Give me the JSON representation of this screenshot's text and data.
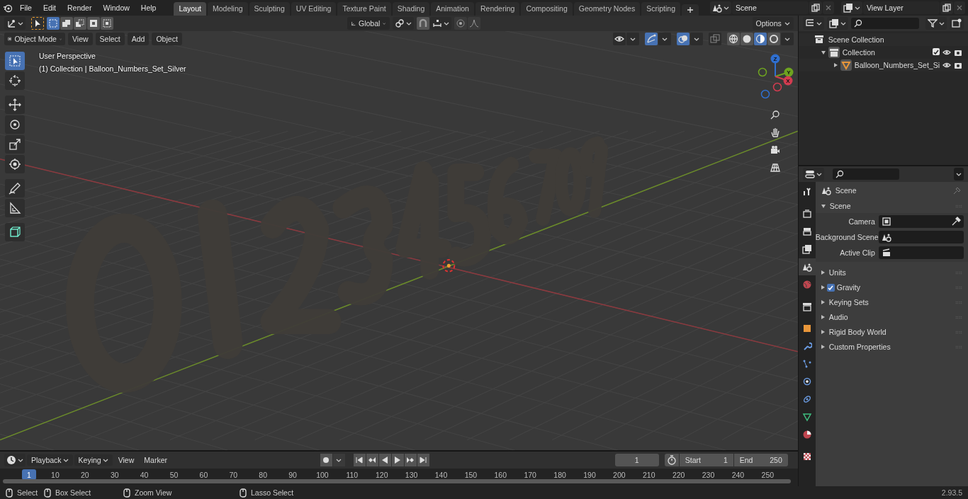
{
  "menu": [
    "File",
    "Edit",
    "Render",
    "Window",
    "Help"
  ],
  "workspaces": [
    {
      "label": "Layout",
      "selected": true
    },
    {
      "label": "Modeling",
      "selected": false
    },
    {
      "label": "Sculpting",
      "selected": false
    },
    {
      "label": "UV Editing",
      "selected": false
    },
    {
      "label": "Texture Paint",
      "selected": false
    },
    {
      "label": "Shading",
      "selected": false
    },
    {
      "label": "Animation",
      "selected": false
    },
    {
      "label": "Rendering",
      "selected": false
    },
    {
      "label": "Compositing",
      "selected": false
    },
    {
      "label": "Geometry Nodes",
      "selected": false
    },
    {
      "label": "Scripting",
      "selected": false
    }
  ],
  "scene_selector": {
    "value": "Scene"
  },
  "view_layer_selector": {
    "value": "View Layer"
  },
  "tool_header": {
    "select_modes": [
      {
        "kind": "set",
        "selected": true
      },
      {
        "kind": "extend",
        "selected": false
      },
      {
        "kind": "subtract",
        "selected": false
      },
      {
        "kind": "difference",
        "selected": false
      },
      {
        "kind": "intersect",
        "selected": false
      }
    ],
    "orientation": "Global",
    "options": "Options"
  },
  "viewport_header": {
    "mode": "Object Mode",
    "menus": [
      "View",
      "Select",
      "Add",
      "Object"
    ],
    "toggles": [
      {
        "kind": "visibility",
        "on": false
      },
      {
        "kind": "gizmos",
        "on": true
      },
      {
        "kind": "overlays",
        "on": true
      },
      {
        "kind": "xray",
        "on": false
      }
    ],
    "shading": [
      {
        "kind": "wireframe",
        "selected": false
      },
      {
        "kind": "solid",
        "selected": false
      },
      {
        "kind": "material",
        "selected": true
      },
      {
        "kind": "rendered",
        "selected": false
      }
    ]
  },
  "viewport": {
    "perspective": "User Perspective",
    "collection_info": "(1) Collection | Balloon_Numbers_Set_Silver",
    "tools": [
      {
        "kind": "select",
        "selected": true
      },
      {
        "kind": "cursor",
        "selected": false
      },
      {
        "kind": "move",
        "selected": false
      },
      {
        "kind": "rotate",
        "selected": false
      },
      {
        "kind": "scale",
        "selected": false
      },
      {
        "kind": "transform",
        "selected": false
      },
      {
        "kind": "annotate",
        "selected": false
      },
      {
        "kind": "measure",
        "selected": false
      },
      {
        "kind": "add_cube",
        "selected": false
      }
    ],
    "gizmo_axes": [
      {
        "label": "Z",
        "color": "#2f6fd0"
      },
      {
        "label": "Y",
        "color": "#6ea320"
      },
      {
        "label": "X",
        "color": "#d33c50"
      }
    ]
  },
  "outliner": {
    "tree": [
      {
        "label": "Scene Collection",
        "children": [
          {
            "label": "Collection",
            "expanded": true,
            "checked": true,
            "children": [
              {
                "label": "Balloon_Numbers_Set_Si",
                "expanded": false
              }
            ]
          }
        ]
      }
    ]
  },
  "properties": {
    "tabs": [
      {
        "kind": "tool",
        "selected": false
      },
      {
        "kind": "render",
        "selected": false
      },
      {
        "kind": "output",
        "selected": false
      },
      {
        "kind": "view_layer",
        "selected": false
      },
      {
        "kind": "scene",
        "selected": true
      },
      {
        "kind": "world",
        "selected": false
      },
      {
        "kind": "collection",
        "selected": false
      },
      {
        "kind": "object",
        "selected": false
      },
      {
        "kind": "modifiers",
        "selected": false
      },
      {
        "kind": "particles",
        "selected": false
      },
      {
        "kind": "physics",
        "selected": false
      },
      {
        "kind": "constraints",
        "selected": false
      },
      {
        "kind": "data",
        "selected": false
      },
      {
        "kind": "material",
        "selected": false
      },
      {
        "kind": "texture",
        "selected": false
      }
    ],
    "context": "Scene",
    "panel": {
      "title": "Scene",
      "expanded": true,
      "fields": [
        {
          "label": "Camera",
          "kind": "camera"
        },
        {
          "label": "Background Scene",
          "kind": "scene"
        },
        {
          "label": "Active Clip",
          "kind": "clip"
        }
      ]
    },
    "subpanels": [
      {
        "title": "Units",
        "expanded": false
      },
      {
        "title": "Gravity",
        "expanded": false,
        "checked": true
      },
      {
        "title": "Keying Sets",
        "expanded": false
      },
      {
        "title": "Audio",
        "expanded": false
      },
      {
        "title": "Rigid Body World",
        "expanded": false
      },
      {
        "title": "Custom Properties",
        "expanded": false
      }
    ]
  },
  "timeline": {
    "menus": [
      "Playback",
      "Keying",
      "View",
      "Marker"
    ],
    "current_frame": "1",
    "start_label": "Start",
    "start": "1",
    "end_label": "End",
    "end": "250",
    "playhead": "1",
    "ruler": [
      "10",
      "20",
      "30",
      "40",
      "50",
      "60",
      "70",
      "80",
      "90",
      "100",
      "110",
      "120",
      "130",
      "140",
      "150",
      "160",
      "170",
      "180",
      "190",
      "200",
      "210",
      "220",
      "230",
      "240",
      "250"
    ]
  },
  "status_bar": {
    "hints": [
      "Select",
      "Box Select",
      "Zoom View",
      "Lasso Select"
    ],
    "version": "2.93.5"
  }
}
